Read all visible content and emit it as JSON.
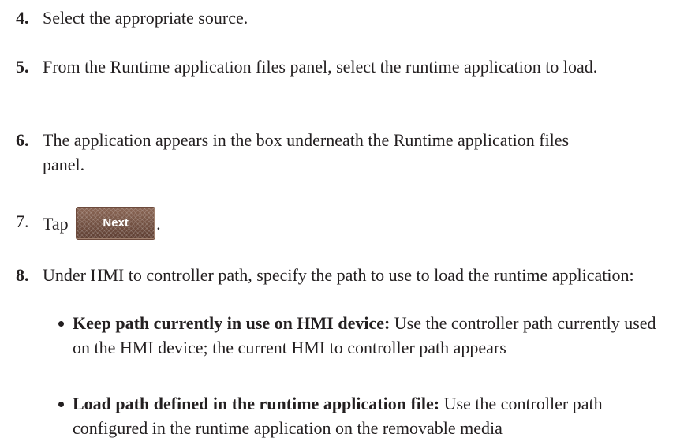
{
  "steps": [
    {
      "num": "4.",
      "text": "Select the appropriate source."
    },
    {
      "num": "5.",
      "text": "From the Runtime application files panel, select the runtime application to load."
    },
    {
      "num": "6.",
      "text": "The application appears in the box underneath the Runtime application files panel."
    },
    {
      "num": "7.",
      "text_before": "Tap",
      "button_label": "Next",
      "text_after": "."
    },
    {
      "num": "8.",
      "text": "Under HMI to controller path, specify the path to use to load the runtime application:"
    }
  ],
  "bullets": [
    {
      "term": "Keep path currently in use on HMI device:",
      "text": " Use the controller path currently used on the HMI device; the current HMI to controller path appears"
    },
    {
      "term": "Load path defined in the runtime application file:",
      "text": " Use the controller path configured in the runtime application on the removable media"
    }
  ]
}
